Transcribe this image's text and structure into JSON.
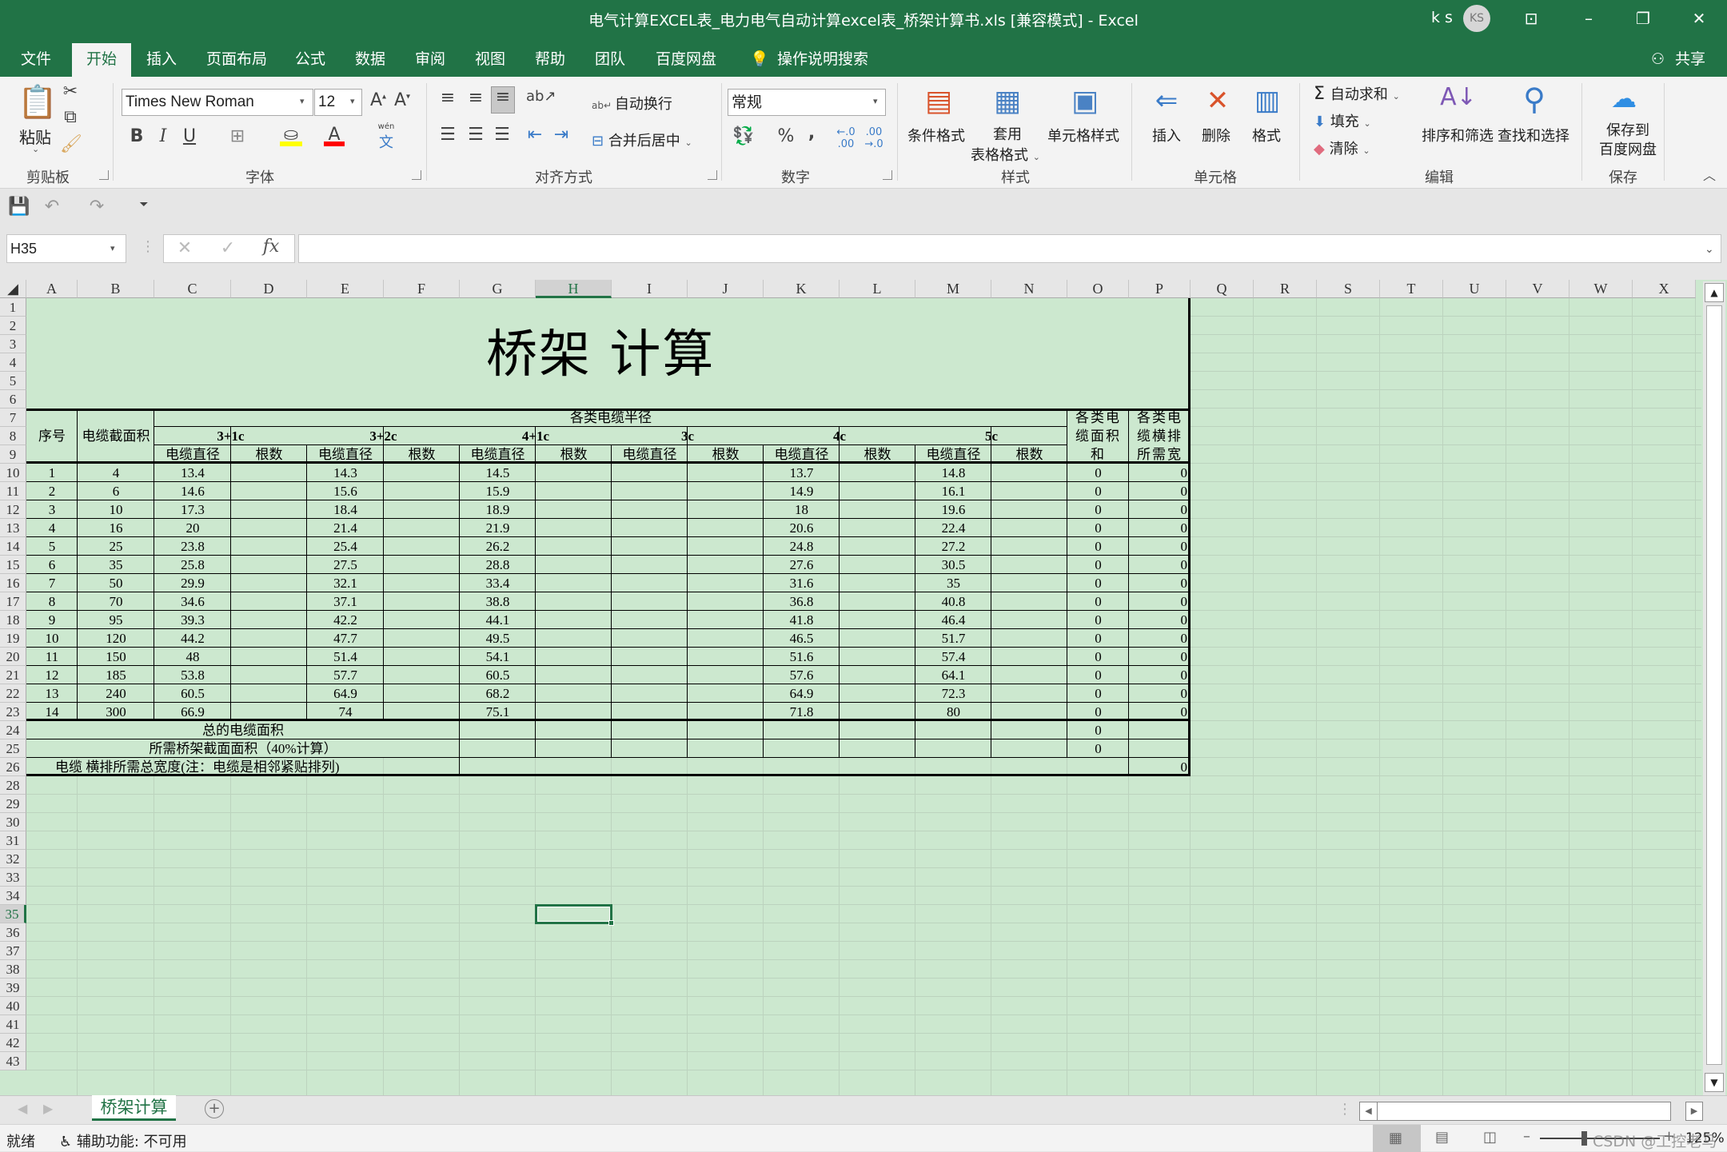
{
  "window": {
    "title": "电气计算EXCEL表_电力电气自动计算excel表_桥架计算书.xls  [兼容模式]  -  Excel",
    "user_name": "k s",
    "user_initials": "KS",
    "share_label": "共享"
  },
  "tabs": [
    "文件",
    "开始",
    "插入",
    "页面布局",
    "公式",
    "数据",
    "审阅",
    "视图",
    "帮助",
    "团队",
    "百度网盘"
  ],
  "active_tab": "开始",
  "tell_me": "操作说明搜索",
  "ribbon": {
    "clipboard": {
      "paste": "粘贴",
      "label": "剪贴板"
    },
    "font": {
      "name": "Times New Roman",
      "size": "12",
      "label": "字体",
      "wen": "wén"
    },
    "alignment": {
      "wrap": "自动换行",
      "merge": "合并后居中",
      "label": "对齐方式"
    },
    "number": {
      "format": "常规",
      "percent": "%",
      "comma": ",",
      "label": "数字"
    },
    "styles": {
      "conditional": "条件格式",
      "table1": "套用",
      "table2": "表格格式",
      "cell_styles": "单元格样式",
      "label": "样式"
    },
    "cells": {
      "insert": "插入",
      "delete": "删除",
      "format": "格式",
      "label": "单元格"
    },
    "editing": {
      "autosum": "自动求和",
      "fill": "填充",
      "clear": "清除",
      "sort": "排序和筛选",
      "find": "查找和选择",
      "label": "编辑"
    },
    "save": {
      "line1": "保存到",
      "line2": "百度网盘",
      "label": "保存"
    }
  },
  "formula_bar": {
    "name_box": "H35",
    "fx": "fx",
    "formula": ""
  },
  "columns": [
    "A",
    "B",
    "C",
    "D",
    "E",
    "F",
    "G",
    "H",
    "I",
    "J",
    "K",
    "L",
    "M",
    "N",
    "O",
    "P",
    "Q",
    "R",
    "S",
    "T",
    "U",
    "V",
    "W",
    "X"
  ],
  "selected_column": "H",
  "selected_row": 35,
  "rows": [
    1,
    2,
    3,
    4,
    5,
    6,
    7,
    8,
    9,
    10,
    11,
    12,
    13,
    14,
    15,
    16,
    17,
    18,
    19,
    20,
    21,
    22,
    23,
    24,
    25,
    26,
    28,
    29,
    30,
    31,
    32,
    33,
    34,
    35,
    36,
    37,
    38,
    39,
    40,
    41,
    42,
    43
  ],
  "sheet": {
    "title": "桥架 计算",
    "header_group": "各类电缆半径",
    "col_seq": "序号",
    "col_section": "电缆截面积",
    "types": [
      "3+1c",
      "3+2c",
      "4+1c",
      "3c",
      "4c",
      "5c"
    ],
    "sub_diameter": "电缆直径",
    "sub_count": "根数",
    "col_area_sum": "各类电缆面积和",
    "col_width_sum": "各类电缆横排所需宽",
    "data": [
      {
        "seq": "1",
        "section": "4",
        "d31": "13.4",
        "d32": "14.3",
        "d41": "14.5",
        "d3": "",
        "d4": "13.7",
        "d5": "14.8",
        "area": "0",
        "width": "0"
      },
      {
        "seq": "2",
        "section": "6",
        "d31": "14.6",
        "d32": "15.6",
        "d41": "15.9",
        "d3": "",
        "d4": "14.9",
        "d5": "16.1",
        "area": "0",
        "width": "0"
      },
      {
        "seq": "3",
        "section": "10",
        "d31": "17.3",
        "d32": "18.4",
        "d41": "18.9",
        "d3": "",
        "d4": "18",
        "d5": "19.6",
        "area": "0",
        "width": "0"
      },
      {
        "seq": "4",
        "section": "16",
        "d31": "20",
        "d32": "21.4",
        "d41": "21.9",
        "d3": "",
        "d4": "20.6",
        "d5": "22.4",
        "area": "0",
        "width": "0"
      },
      {
        "seq": "5",
        "section": "25",
        "d31": "23.8",
        "d32": "25.4",
        "d41": "26.2",
        "d3": "",
        "d4": "24.8",
        "d5": "27.2",
        "area": "0",
        "width": "0"
      },
      {
        "seq": "6",
        "section": "35",
        "d31": "25.8",
        "d32": "27.5",
        "d41": "28.8",
        "d3": "",
        "d4": "27.6",
        "d5": "30.5",
        "area": "0",
        "width": "0"
      },
      {
        "seq": "7",
        "section": "50",
        "d31": "29.9",
        "d32": "32.1",
        "d41": "33.4",
        "d3": "",
        "d4": "31.6",
        "d5": "35",
        "area": "0",
        "width": "0"
      },
      {
        "seq": "8",
        "section": "70",
        "d31": "34.6",
        "d32": "37.1",
        "d41": "38.8",
        "d3": "",
        "d4": "36.8",
        "d5": "40.8",
        "area": "0",
        "width": "0"
      },
      {
        "seq": "9",
        "section": "95",
        "d31": "39.3",
        "d32": "42.2",
        "d41": "44.1",
        "d3": "",
        "d4": "41.8",
        "d5": "46.4",
        "area": "0",
        "width": "0"
      },
      {
        "seq": "10",
        "section": "120",
        "d31": "44.2",
        "d32": "47.7",
        "d41": "49.5",
        "d3": "",
        "d4": "46.5",
        "d5": "51.7",
        "area": "0",
        "width": "0"
      },
      {
        "seq": "11",
        "section": "150",
        "d31": "48",
        "d32": "51.4",
        "d41": "54.1",
        "d3": "",
        "d4": "51.6",
        "d5": "57.4",
        "area": "0",
        "width": "0"
      },
      {
        "seq": "12",
        "section": "185",
        "d31": "53.8",
        "d32": "57.7",
        "d41": "60.5",
        "d3": "",
        "d4": "57.6",
        "d5": "64.1",
        "area": "0",
        "width": "0"
      },
      {
        "seq": "13",
        "section": "240",
        "d31": "60.5",
        "d32": "64.9",
        "d41": "68.2",
        "d3": "",
        "d4": "64.9",
        "d5": "72.3",
        "area": "0",
        "width": "0"
      },
      {
        "seq": "14",
        "section": "300",
        "d31": "66.9",
        "d32": "74",
        "d41": "75.1",
        "d3": "",
        "d4": "71.8",
        "d5": "80",
        "area": "0",
        "width": "0"
      }
    ],
    "total_area_label": "总的电缆面积",
    "total_area_value": "0",
    "tray_area_label": "所需桥架截面面积（40%计算）",
    "tray_area_value": "0",
    "total_width_label": "电缆 横排所需总宽度(注：电缆是相邻紧贴排列)",
    "total_width_value": "0"
  },
  "sheet_tabs": [
    "桥架计算"
  ],
  "status": {
    "ready": "就绪",
    "accessibility": "辅助功能: 不可用",
    "zoom": "125%",
    "watermark": "CSDN @工控老马"
  }
}
